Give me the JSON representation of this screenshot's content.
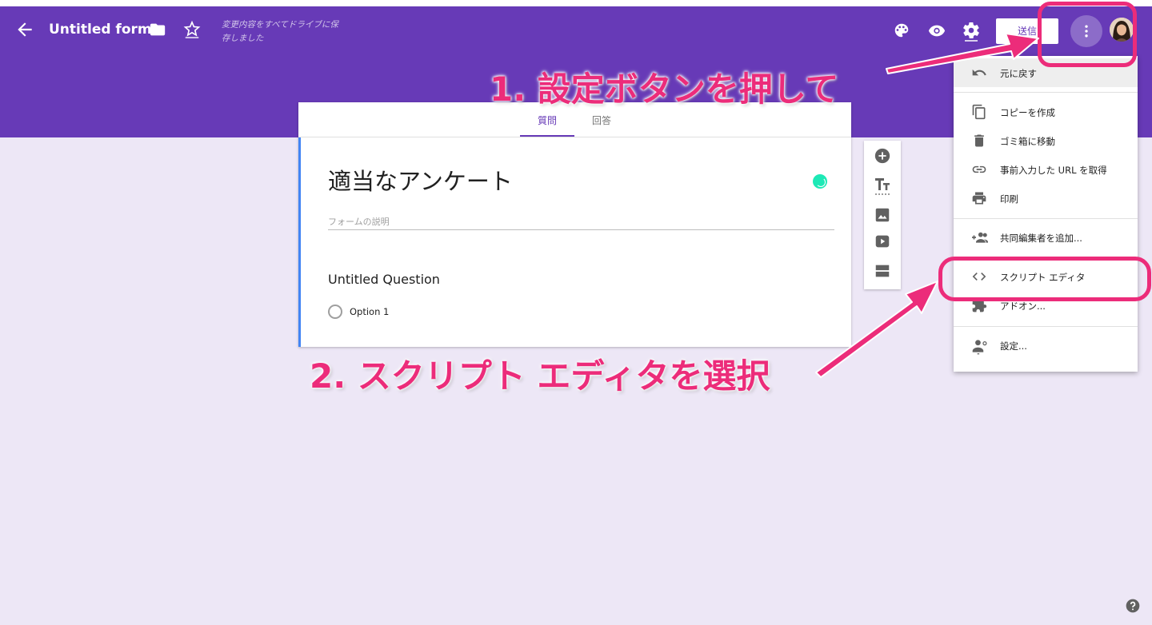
{
  "header": {
    "title": "Untitled form",
    "save_status": "変更内容をすべてドライブに保存しました",
    "send_label": "送信"
  },
  "colors": {
    "header": "#673ab7",
    "background": "#ede7f6",
    "annotation": "#ec2c7a"
  },
  "icons": {
    "back": "arrow-left-icon",
    "folder": "folder-icon",
    "star": "star-outline-icon",
    "palette": "palette-icon",
    "preview": "eye-icon",
    "settings": "gear-icon",
    "more": "more-vert-icon"
  },
  "form": {
    "tabs": [
      {
        "label": "質問",
        "active": true
      },
      {
        "label": "回答",
        "active": false
      }
    ],
    "title": "適当なアンケート",
    "description_placeholder": "フォームの説明",
    "question": {
      "title": "Untitled Question",
      "options": [
        "Option 1"
      ]
    }
  },
  "toolbar": [
    "add-question-icon",
    "title-text-icon",
    "image-icon",
    "video-icon",
    "section-icon"
  ],
  "menu": {
    "items": [
      {
        "label": "元に戻す",
        "icon": "undo-icon"
      },
      {
        "label": "コピーを作成",
        "icon": "copy-icon"
      },
      {
        "label": "ゴミ箱に移動",
        "icon": "trash-icon"
      },
      {
        "label": "事前入力した URL を取得",
        "icon": "link-icon"
      },
      {
        "label": "印刷",
        "icon": "print-icon"
      },
      {
        "label": "共同編集者を追加...",
        "icon": "add-people-icon"
      },
      {
        "label": "スクリプト エディタ",
        "icon": "code-icon"
      },
      {
        "label": "アドオン...",
        "icon": "puzzle-icon"
      },
      {
        "label": "設定...",
        "icon": "person-settings-icon"
      }
    ]
  },
  "annotations": {
    "step1": "1. 設定ボタンを押して",
    "step2": "2. スクリプト エディタを選択"
  }
}
